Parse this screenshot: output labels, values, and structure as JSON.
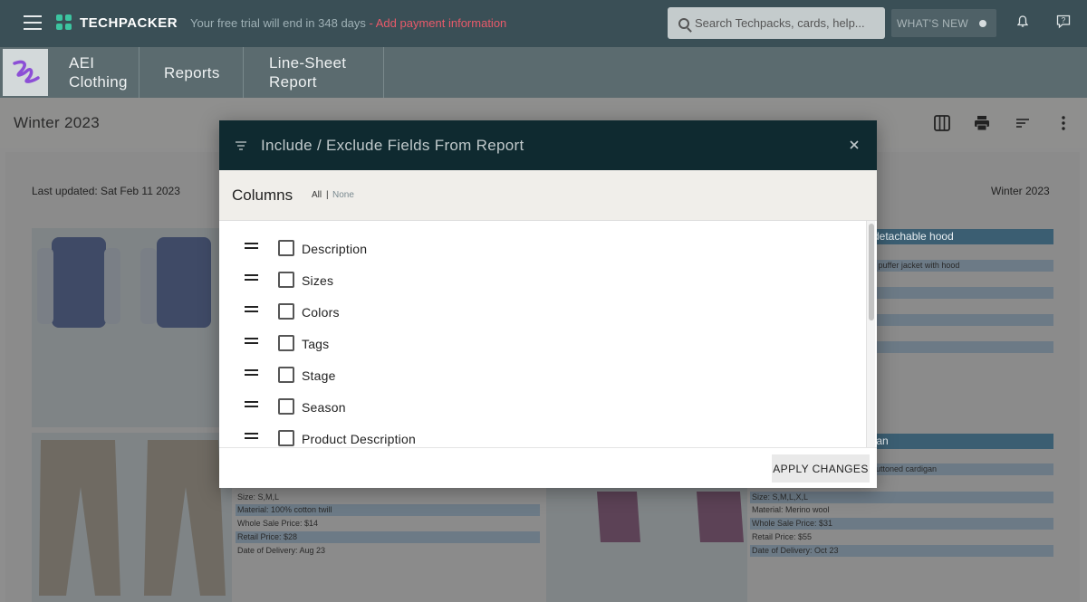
{
  "topbar": {
    "logo_text": "TECHPACKER",
    "trial_text": "Your free trial will end in 348 days",
    "trial_link": " - Add payment information",
    "search_placeholder": "Search Techpacks, cards, help...",
    "whats_new_label": "WHAT'S NEW"
  },
  "nav": {
    "tabs": [
      {
        "label": "AEI Clothing"
      },
      {
        "label": "Reports"
      },
      {
        "label": "Line-Sheet Report"
      }
    ]
  },
  "page": {
    "season_title": "Winter 2023"
  },
  "report": {
    "last_updated": "Last updated: Sat Feb 11 2023",
    "season": "Winter 2023",
    "cards": [
      {
        "title": "detachable hood",
        "rows": [
          "d puffer jacket with hood",
          "",
          "",
          ""
        ]
      },
      {
        "title": "",
        "rows": [
          "Size: S,M,L",
          "Material: 100% cotton twill",
          "Whole Sale Price: $14",
          "Retail Price: $28",
          "Date of Delivery: Aug 23"
        ]
      },
      {
        "title": "tan",
        "rows": [
          "buttoned cardigan",
          "",
          "Size: S,M,L,X,L",
          "Material: Merino wool",
          "Whole Sale Price: $31",
          "Retail Price: $55",
          "Date of Delivery: Oct 23"
        ]
      }
    ]
  },
  "modal": {
    "title": "Include / Exclude Fields From Report",
    "columns_label": "Columns",
    "all_label": "All",
    "separator": "|",
    "none_label": "None",
    "fields": [
      {
        "label": "Description"
      },
      {
        "label": "Sizes"
      },
      {
        "label": "Colors"
      },
      {
        "label": "Tags"
      },
      {
        "label": "Stage"
      },
      {
        "label": "Season"
      },
      {
        "label": "Product Description"
      }
    ],
    "apply_label": "APPLY CHANGES"
  },
  "colors": {
    "topbar": "#3a4f56",
    "modal_header": "#0f2a30",
    "accent_link": "#e85a6a",
    "card_title": "#3b5e72"
  }
}
